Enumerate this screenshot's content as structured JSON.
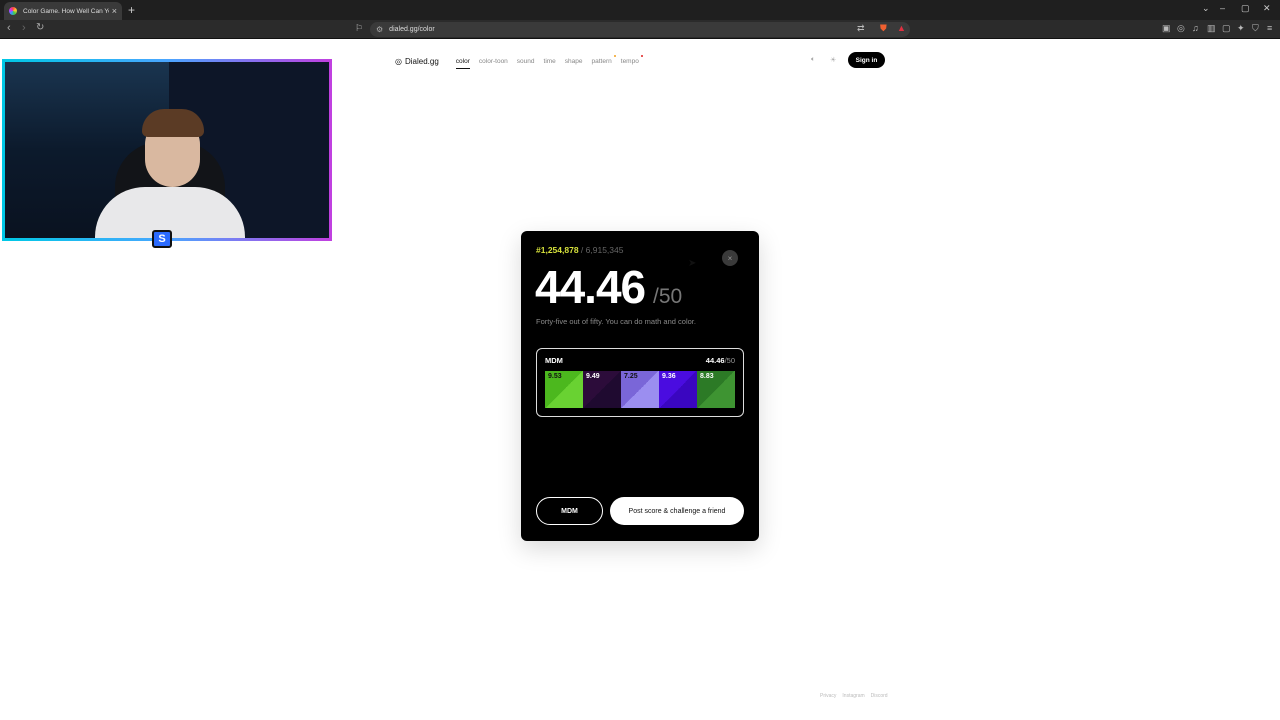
{
  "browser": {
    "tab_title": "Color Game. How Well Can You",
    "tab_close": "×",
    "new_tab": "+",
    "url": "dialed.gg/color",
    "window_controls": [
      "⌄",
      "–",
      "▢",
      "✕"
    ]
  },
  "site": {
    "brand": "Dialed.gg",
    "nav": [
      {
        "label": "color",
        "active": true
      },
      {
        "label": "color-toon"
      },
      {
        "label": "sound"
      },
      {
        "label": "time"
      },
      {
        "label": "shape"
      },
      {
        "label": "pattern",
        "dot_color": "#f0a020"
      },
      {
        "label": "tempo",
        "dot_color": "#e02020"
      }
    ],
    "sign_in": "Sign in",
    "footer": [
      "Privacy",
      "Instagram",
      "Discord"
    ]
  },
  "result": {
    "rank": "#1,254,878",
    "total": "/ 6,915,345",
    "score": "44.46",
    "score_of": "/50",
    "description": "Forty-five out of fifty. You can do math and color.",
    "close": "×",
    "card": {
      "name": "MDM",
      "score": "44.46",
      "score_of": "/50",
      "swatches": [
        {
          "value": "9.53",
          "target": "#4cb81e",
          "guess": "#69d232",
          "dark_text": true
        },
        {
          "value": "9.49",
          "target": "#2c0c3a",
          "guess": "#1f0a30"
        },
        {
          "value": "7.25",
          "target": "#7a66d8",
          "guess": "#9b8ef0",
          "dark_text": true
        },
        {
          "value": "9.36",
          "target": "#4a0ce0",
          "guess": "#3a06c0"
        },
        {
          "value": "8.83",
          "target": "#2c7a26",
          "guess": "#3e9432"
        }
      ]
    },
    "btn_user": "MDM",
    "btn_post": "Post score & challenge a friend"
  }
}
